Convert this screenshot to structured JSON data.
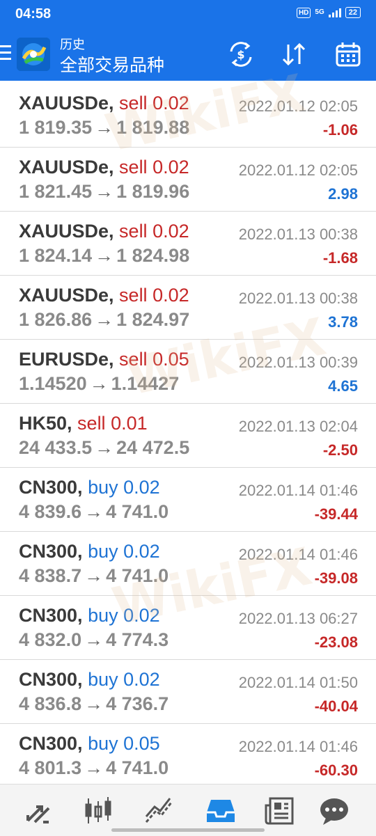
{
  "status_bar": {
    "time": "04:58",
    "hd": "HD",
    "network": "5G",
    "battery": "22"
  },
  "header": {
    "subtitle": "历史",
    "title": "全部交易品种"
  },
  "icons": {
    "menu": "menu-icon",
    "app_logo": "metatrader-logo",
    "currency": "currency-exchange-icon",
    "sort": "sort-icon",
    "calendar": "calendar-icon",
    "nav": [
      "quotes-icon",
      "chart-icon",
      "trade-icon",
      "history-icon",
      "news-icon",
      "chat-icon"
    ]
  },
  "colors": {
    "accent": "#1a73e8",
    "sell": "#c62828",
    "buy": "#1e73d4"
  },
  "trades": [
    {
      "symbol": "XAUUSDe,",
      "side": "sell",
      "volume": "0.02",
      "date": "2022.01.12 02:05",
      "open": "1 819.35",
      "close": "1 819.88",
      "profit": "-1.06"
    },
    {
      "symbol": "XAUUSDe,",
      "side": "sell",
      "volume": "0.02",
      "date": "2022.01.12 02:05",
      "open": "1 821.45",
      "close": "1 819.96",
      "profit": "2.98"
    },
    {
      "symbol": "XAUUSDe,",
      "side": "sell",
      "volume": "0.02",
      "date": "2022.01.13 00:38",
      "open": "1 824.14",
      "close": "1 824.98",
      "profit": "-1.68"
    },
    {
      "symbol": "XAUUSDe,",
      "side": "sell",
      "volume": "0.02",
      "date": "2022.01.13 00:38",
      "open": "1 826.86",
      "close": "1 824.97",
      "profit": "3.78"
    },
    {
      "symbol": "EURUSDe,",
      "side": "sell",
      "volume": "0.05",
      "date": "2022.01.13 00:39",
      "open": "1.14520",
      "close": "1.14427",
      "profit": "4.65"
    },
    {
      "symbol": "HK50,",
      "side": "sell",
      "volume": "0.01",
      "date": "2022.01.13 02:04",
      "open": "24 433.5",
      "close": "24 472.5",
      "profit": "-2.50"
    },
    {
      "symbol": "CN300,",
      "side": "buy",
      "volume": "0.02",
      "date": "2022.01.14 01:46",
      "open": "4 839.6",
      "close": "4 741.0",
      "profit": "-39.44"
    },
    {
      "symbol": "CN300,",
      "side": "buy",
      "volume": "0.02",
      "date": "2022.01.14 01:46",
      "open": "4 838.7",
      "close": "4 741.0",
      "profit": "-39.08"
    },
    {
      "symbol": "CN300,",
      "side": "buy",
      "volume": "0.02",
      "date": "2022.01.13 06:27",
      "open": "4 832.0",
      "close": "4 774.3",
      "profit": "-23.08"
    },
    {
      "symbol": "CN300,",
      "side": "buy",
      "volume": "0.02",
      "date": "2022.01.14 01:50",
      "open": "4 836.8",
      "close": "4 736.7",
      "profit": "-40.04"
    },
    {
      "symbol": "CN300,",
      "side": "buy",
      "volume": "0.05",
      "date": "2022.01.14 01:46",
      "open": "4 801.3",
      "close": "4 741.0",
      "profit": "-60.30"
    }
  ],
  "watermark": "WikiFX"
}
